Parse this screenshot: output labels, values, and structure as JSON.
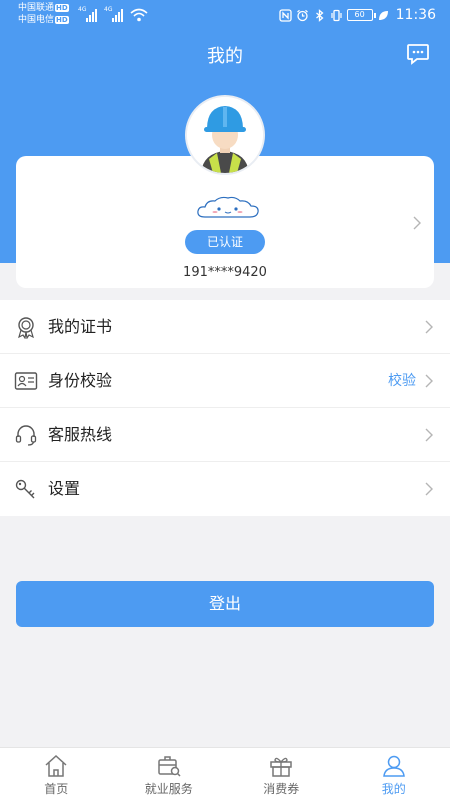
{
  "status_bar": {
    "carrier_1": "中国联通",
    "carrier_2": "中国电信",
    "hd_badge": "HD",
    "net_1": "4G",
    "net_2": "4G",
    "battery": "60",
    "time": "11:36"
  },
  "header": {
    "title": "我的",
    "message_icon": "message-icon"
  },
  "profile": {
    "verified_label": "已认证",
    "phone": "191****9420"
  },
  "menu": [
    {
      "label": "我的证书",
      "icon": "certificate-icon",
      "value": ""
    },
    {
      "label": "身份校验",
      "icon": "id-card-icon",
      "value": "校验"
    },
    {
      "label": "客服热线",
      "icon": "headset-icon",
      "value": ""
    },
    {
      "label": "设置",
      "icon": "key-icon",
      "value": ""
    }
  ],
  "logout_label": "登出",
  "tabs": [
    {
      "label": "首页",
      "icon": "home-icon",
      "active": false
    },
    {
      "label": "就业服务",
      "icon": "briefcase-search-icon",
      "active": false
    },
    {
      "label": "消费券",
      "icon": "gift-icon",
      "active": false
    },
    {
      "label": "我的",
      "icon": "user-icon",
      "active": true
    }
  ],
  "colors": {
    "accent": "#4d9bf2",
    "background": "#f2f2f4"
  }
}
